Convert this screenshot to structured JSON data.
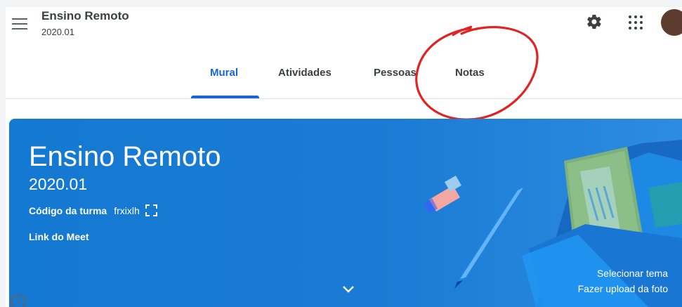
{
  "header": {
    "class_title": "Ensino Remoto",
    "class_subtitle": "2020.01"
  },
  "icons": {
    "menu": "hamburger-menu-icon",
    "settings": "gear-icon",
    "apps": "apps-grid-icon",
    "fullscreen": "fullscreen-icon",
    "expand": "chevron-down-icon",
    "help": "help-icon"
  },
  "tabs": [
    {
      "label": "Mural",
      "active": true
    },
    {
      "label": "Atividades",
      "active": false
    },
    {
      "label": "Pessoas",
      "active": false
    },
    {
      "label": "Notas",
      "active": false
    }
  ],
  "banner": {
    "title": "Ensino Remoto",
    "subtitle": "2020.01",
    "code_label": "Código da turma",
    "code_value": "frxixlh",
    "meet_link": "Link do Meet",
    "select_theme": "Selecionar tema",
    "upload_photo": "Fazer upload da foto"
  },
  "colors": {
    "accent": "#1967d2",
    "banner": "#1479d2",
    "annotation": "#e02424",
    "avatar": "#5d3b2f"
  }
}
